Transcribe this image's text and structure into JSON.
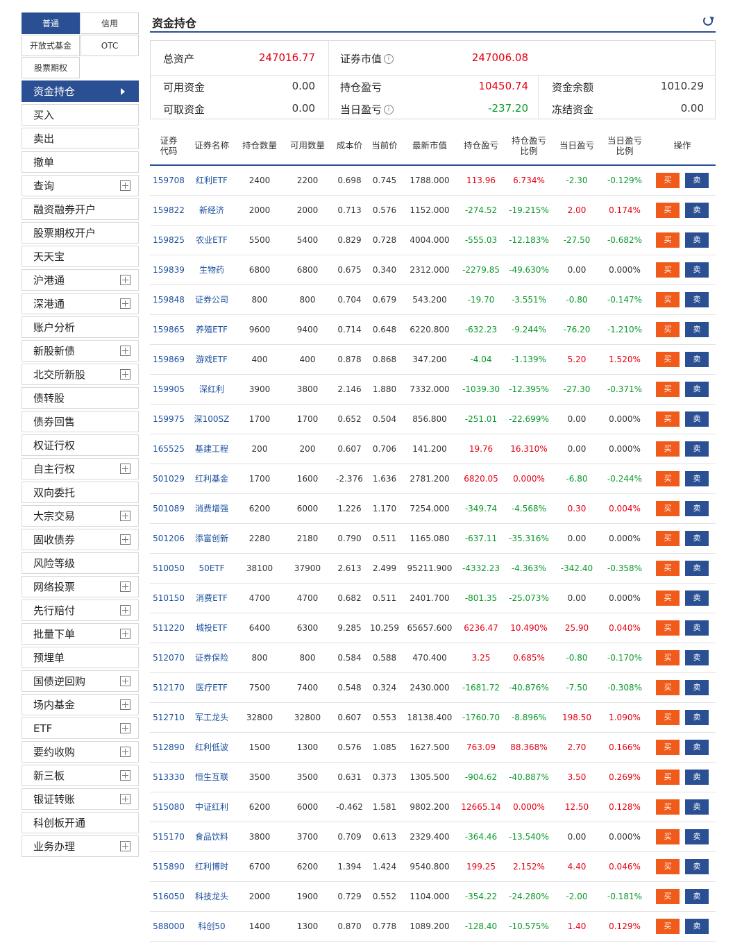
{
  "sidebar": {
    "account_tabs": [
      "普通",
      "信用",
      "开放式基金",
      "OTC",
      "股票期权"
    ],
    "menu": [
      {
        "label": "资金持仓",
        "active": true
      },
      {
        "label": "买入"
      },
      {
        "label": "卖出"
      },
      {
        "label": "撤单"
      },
      {
        "label": "查询",
        "expand": true
      },
      {
        "label": "融资融券开户"
      },
      {
        "label": "股票期权开户"
      },
      {
        "label": "天天宝"
      },
      {
        "label": "沪港通",
        "expand": true
      },
      {
        "label": "深港通",
        "expand": true
      },
      {
        "label": "账户分析"
      },
      {
        "label": "新股新债",
        "expand": true
      },
      {
        "label": "北交所新股",
        "expand": true
      },
      {
        "label": "债转股"
      },
      {
        "label": "债券回售"
      },
      {
        "label": "权证行权"
      },
      {
        "label": "自主行权",
        "expand": true
      },
      {
        "label": "双向委托"
      },
      {
        "label": "大宗交易",
        "expand": true
      },
      {
        "label": "固收债券",
        "expand": true
      },
      {
        "label": "风险等级"
      },
      {
        "label": "网络投票",
        "expand": true
      },
      {
        "label": "先行赔付",
        "expand": true
      },
      {
        "label": "批量下单",
        "expand": true
      },
      {
        "label": "预埋单"
      },
      {
        "label": "国债逆回购",
        "expand": true
      },
      {
        "label": "场内基金",
        "expand": true
      },
      {
        "label": "ETF",
        "expand": true
      },
      {
        "label": "要约收购",
        "expand": true
      },
      {
        "label": "新三板",
        "expand": true
      },
      {
        "label": "银证转账",
        "expand": true
      },
      {
        "label": "科创板开通"
      },
      {
        "label": "业务办理",
        "expand": true
      }
    ]
  },
  "main": {
    "title": "资金持仓",
    "summary": {
      "total_assets_label": "总资产",
      "total_assets": "247016.77",
      "market_value_label": "证券市值",
      "market_value": "247006.08",
      "available_label": "可用资金",
      "available": "0.00",
      "holding_pl_label": "持仓盈亏",
      "holding_pl": "10450.74",
      "balance_label": "资金余额",
      "balance": "1010.29",
      "withdrawable_label": "可取资金",
      "withdrawable": "0.00",
      "today_pl_label": "当日盈亏",
      "today_pl": "-237.20",
      "frozen_label": "冻结资金",
      "frozen": "0.00"
    },
    "table": {
      "headers": [
        "证券\n代码",
        "证券名称",
        "持仓数量",
        "可用数量",
        "成本价",
        "当前价",
        "最新市值",
        "持仓盈亏",
        "持仓盈亏\n比例",
        "当日盈亏",
        "当日盈亏\n比例",
        "操作"
      ],
      "buy_label": "买",
      "sell_label": "卖",
      "rows": [
        [
          "159708",
          "红利ETF",
          "2400",
          "2200",
          "0.698",
          "0.745",
          "1788.000",
          "113.96",
          "6.734%",
          "-2.30",
          "-0.129%"
        ],
        [
          "159822",
          "新经济",
          "2000",
          "2000",
          "0.713",
          "0.576",
          "1152.000",
          "-274.52",
          "-19.215%",
          "2.00",
          "0.174%"
        ],
        [
          "159825",
          "农业ETF",
          "5500",
          "5400",
          "0.829",
          "0.728",
          "4004.000",
          "-555.03",
          "-12.183%",
          "-27.50",
          "-0.682%"
        ],
        [
          "159839",
          "生物药",
          "6800",
          "6800",
          "0.675",
          "0.340",
          "2312.000",
          "-2279.85",
          "-49.630%",
          "0.00",
          "0.000%"
        ],
        [
          "159848",
          "证券公司",
          "800",
          "800",
          "0.704",
          "0.679",
          "543.200",
          "-19.70",
          "-3.551%",
          "-0.80",
          "-0.147%"
        ],
        [
          "159865",
          "养殖ETF",
          "9600",
          "9400",
          "0.714",
          "0.648",
          "6220.800",
          "-632.23",
          "-9.244%",
          "-76.20",
          "-1.210%"
        ],
        [
          "159869",
          "游戏ETF",
          "400",
          "400",
          "0.878",
          "0.868",
          "347.200",
          "-4.04",
          "-1.139%",
          "5.20",
          "1.520%"
        ],
        [
          "159905",
          "深红利",
          "3900",
          "3800",
          "2.146",
          "1.880",
          "7332.000",
          "-1039.30",
          "-12.395%",
          "-27.30",
          "-0.371%"
        ],
        [
          "159975",
          "深100SZ",
          "1700",
          "1700",
          "0.652",
          "0.504",
          "856.800",
          "-251.01",
          "-22.699%",
          "0.00",
          "0.000%"
        ],
        [
          "165525",
          "基建工程",
          "200",
          "200",
          "0.607",
          "0.706",
          "141.200",
          "19.76",
          "16.310%",
          "0.00",
          "0.000%"
        ],
        [
          "501029",
          "红利基金",
          "1700",
          "1600",
          "-2.376",
          "1.636",
          "2781.200",
          "6820.05",
          "0.000%",
          "-6.80",
          "-0.244%"
        ],
        [
          "501089",
          "消费增强",
          "6200",
          "6000",
          "1.226",
          "1.170",
          "7254.000",
          "-349.74",
          "-4.568%",
          "0.30",
          "0.004%"
        ],
        [
          "501206",
          "添富创新",
          "2280",
          "2180",
          "0.790",
          "0.511",
          "1165.080",
          "-637.11",
          "-35.316%",
          "0.00",
          "0.000%"
        ],
        [
          "510050",
          "50ETF",
          "38100",
          "37900",
          "2.613",
          "2.499",
          "95211.900",
          "-4332.23",
          "-4.363%",
          "-342.40",
          "-0.358%"
        ],
        [
          "510150",
          "消费ETF",
          "4700",
          "4700",
          "0.682",
          "0.511",
          "2401.700",
          "-801.35",
          "-25.073%",
          "0.00",
          "0.000%"
        ],
        [
          "511220",
          "城投ETF",
          "6400",
          "6300",
          "9.285",
          "10.259",
          "65657.600",
          "6236.47",
          "10.490%",
          "25.90",
          "0.040%"
        ],
        [
          "512070",
          "证券保险",
          "800",
          "800",
          "0.584",
          "0.588",
          "470.400",
          "3.25",
          "0.685%",
          "-0.80",
          "-0.170%"
        ],
        [
          "512170",
          "医疗ETF",
          "7500",
          "7400",
          "0.548",
          "0.324",
          "2430.000",
          "-1681.72",
          "-40.876%",
          "-7.50",
          "-0.308%"
        ],
        [
          "512710",
          "军工龙头",
          "32800",
          "32800",
          "0.607",
          "0.553",
          "18138.400",
          "-1760.70",
          "-8.896%",
          "198.50",
          "1.090%"
        ],
        [
          "512890",
          "红利低波",
          "1500",
          "1300",
          "0.576",
          "1.085",
          "1627.500",
          "763.09",
          "88.368%",
          "2.70",
          "0.166%"
        ],
        [
          "513330",
          "恒生互联",
          "3500",
          "3500",
          "0.631",
          "0.373",
          "1305.500",
          "-904.62",
          "-40.887%",
          "3.50",
          "0.269%"
        ],
        [
          "515080",
          "中证红利",
          "6200",
          "6000",
          "-0.462",
          "1.581",
          "9802.200",
          "12665.14",
          "0.000%",
          "12.50",
          "0.128%"
        ],
        [
          "515170",
          "食品饮料",
          "3800",
          "3700",
          "0.709",
          "0.613",
          "2329.400",
          "-364.46",
          "-13.540%",
          "0.00",
          "0.000%"
        ],
        [
          "515890",
          "红利博时",
          "6700",
          "6200",
          "1.394",
          "1.424",
          "9540.800",
          "199.25",
          "2.152%",
          "4.40",
          "0.046%"
        ],
        [
          "516050",
          "科技龙头",
          "2000",
          "1900",
          "0.729",
          "0.552",
          "1104.000",
          "-354.22",
          "-24.280%",
          "-2.00",
          "-0.181%"
        ],
        [
          "588000",
          "科创50",
          "1400",
          "1300",
          "0.870",
          "0.778",
          "1089.200",
          "-128.40",
          "-10.575%",
          "1.40",
          "0.129%"
        ]
      ]
    }
  },
  "colors": {
    "accent": "#2b4f93",
    "buy": "#f05a1a",
    "up": "#e60012",
    "down": "#0a9a2a"
  }
}
